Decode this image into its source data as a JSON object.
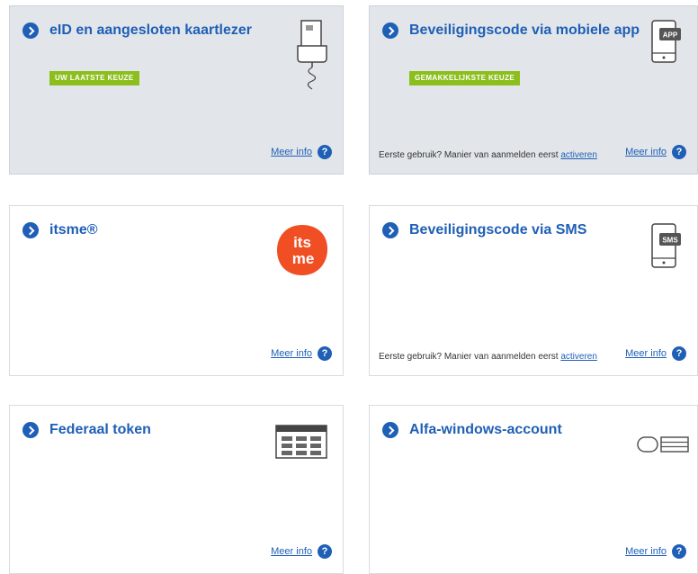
{
  "cards": [
    {
      "title": "eID en aangesloten kaartlezer",
      "badge": "UW LAATSTE KEUZE",
      "meer_info": "Meer info",
      "help": "?",
      "selected": true,
      "icon": "card-reader-icon"
    },
    {
      "title": "Beveiligingscode via mobiele app",
      "badge": "GEMAKKELIJKSTE KEUZE",
      "first_use_text": "Eerste gebruik? Manier van aanmelden eerst",
      "activate_link": "activeren",
      "meer_info": "Meer info",
      "help": "?",
      "icon": "mobile-app-icon",
      "icon_label": "APP"
    },
    {
      "title": "itsme®",
      "meer_info": "Meer info",
      "help": "?",
      "icon": "itsme-logo",
      "logo_text": [
        "its",
        "me"
      ],
      "logo_color": "#f04e23"
    },
    {
      "title": "Beveiligingscode via SMS",
      "first_use_text": "Eerste gebruik? Manier van aanmelden eerst",
      "activate_link": "activeren",
      "meer_info": "Meer info",
      "help": "?",
      "icon": "sms-phone-icon",
      "icon_label": "SMS"
    },
    {
      "title": "Federaal token",
      "meer_info": "Meer info",
      "help": "?",
      "icon": "token-card-icon"
    },
    {
      "title": "Alfa-windows-account",
      "meer_info": "Meer info",
      "help": "?",
      "icon": "windows-account-icon"
    }
  ],
  "colors": {
    "accent": "#1f5fb6",
    "badge_green": "#8cbf1e",
    "selected_bg": "#e2e6ea",
    "itsme_orange": "#f04e23"
  }
}
